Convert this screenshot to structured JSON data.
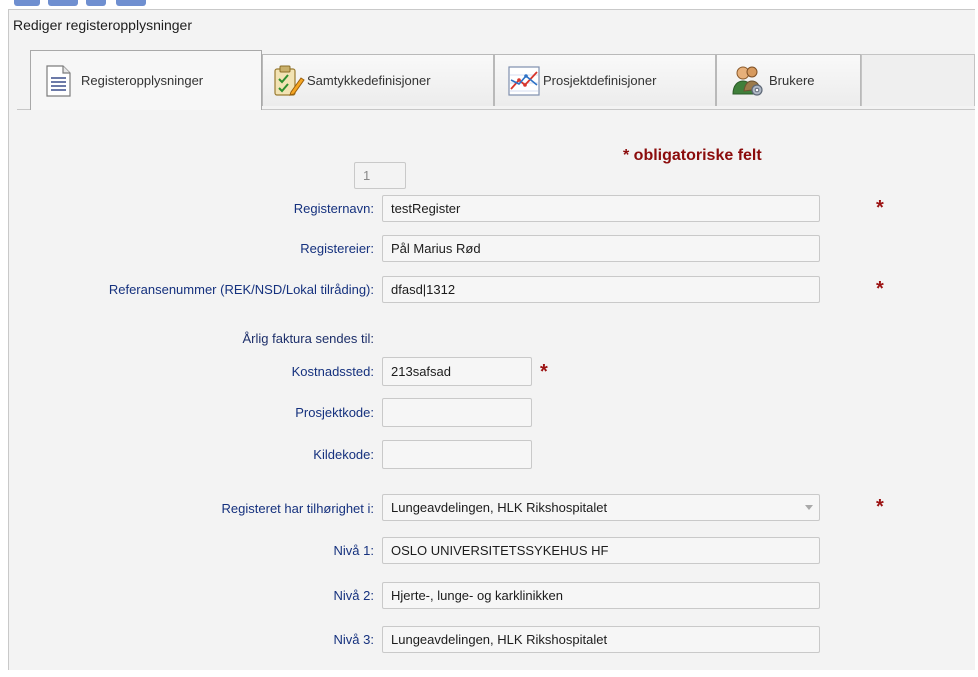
{
  "window": {
    "title": "Rediger registeropplysninger"
  },
  "tabs": [
    {
      "label": "Registeropplysninger",
      "icon": "document-icon"
    },
    {
      "label": "Samtykkedefinisjoner",
      "icon": "clipboard-pen-icon"
    },
    {
      "label": "Prosjektdefinisjoner",
      "icon": "chart-icon"
    },
    {
      "label": "Brukere",
      "icon": "users-gear-icon"
    }
  ],
  "form": {
    "required_note": "* obligatoriske felt",
    "id_value": "1",
    "register_name": {
      "label": "Registernavn:",
      "value": "testRegister"
    },
    "register_owner": {
      "label": "Registereier:",
      "value": "Pål Marius Rød"
    },
    "reference_number": {
      "label": "Referansenummer (REK/NSD/Lokal tilråding):",
      "value": "dfasd|1312"
    },
    "invoice_heading": "Årlig faktura sendes til:",
    "cost_center": {
      "label": "Kostnadssted:",
      "value": "213safsad"
    },
    "project_code": {
      "label": "Prosjektkode:",
      "value": ""
    },
    "source_code": {
      "label": "Kildekode:",
      "value": ""
    },
    "belongs_to": {
      "label": "Registeret har tilhørighet i:",
      "value": "Lungeavdelingen, HLK Rikshospitalet"
    },
    "level1": {
      "label": "Nivå 1:",
      "value": "OSLO UNIVERSITETSSYKEHUS HF"
    },
    "level2": {
      "label": "Nivå 2:",
      "value": "Hjerte-, lunge- og karklinikken"
    },
    "level3": {
      "label": "Nivå 3:",
      "value": "Lungeavdelingen, HLK Rikshospitalet"
    },
    "star": "*"
  },
  "colors": {
    "label": "#15317e",
    "required": "#9b1111",
    "background": "#f3f3f3"
  }
}
